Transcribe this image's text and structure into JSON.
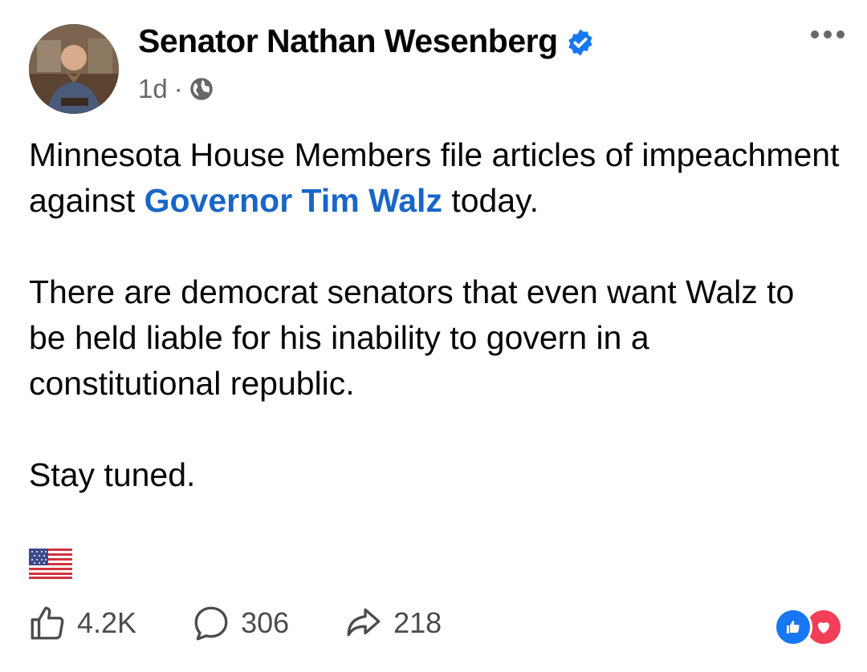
{
  "post": {
    "author": "Senator Nathan Wesenberg",
    "time": "1d",
    "separator": "·",
    "body": {
      "p1_before": "Minnesota House Members file articles of impeachment against ",
      "p1_mention": "Governor Tim Walz",
      "p1_after": " today.",
      "p2": "There are democrat senators that even want Walz to be held liable for his inability to govern in a constitutional republic.",
      "p3": "Stay tuned."
    }
  },
  "actions": {
    "likes": "4.2K",
    "comments": "306",
    "shares": "218"
  },
  "icons": {
    "verified": "verified-badge-icon",
    "audience": "globe-icon",
    "more": "more-options-icon",
    "flag": "us-flag-emoji",
    "like": "thumbs-up-icon",
    "comment": "comment-bubble-icon",
    "share": "share-arrow-icon"
  },
  "colors": {
    "accent": "#1866c8",
    "verified": "#1877f2",
    "like_reaction": "#1877f2",
    "love_reaction": "#f33e58",
    "secondary_text": "#65676b"
  }
}
